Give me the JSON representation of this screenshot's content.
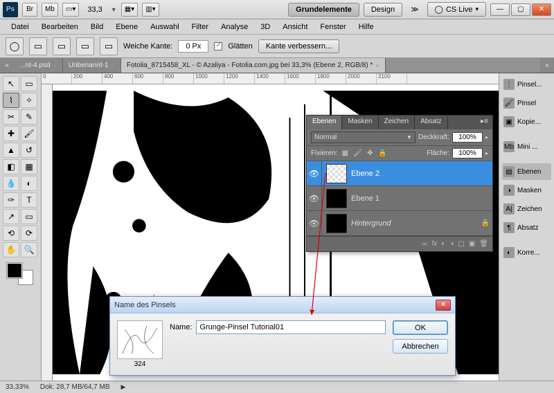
{
  "titlebar": {
    "app_abbrev": "Ps",
    "small_buttons": [
      "Br",
      "Mb"
    ],
    "zoom": "33,3",
    "workspace_tabs": {
      "active": "Grundelemente",
      "other": "Design"
    },
    "cslive": "CS Live"
  },
  "menubar": [
    "Datei",
    "Bearbeiten",
    "Bild",
    "Ebene",
    "Auswahl",
    "Filter",
    "Analyse",
    "3D",
    "Ansicht",
    "Fenster",
    "Hilfe"
  ],
  "optionbar": {
    "weiche_kante_label": "Weiche Kante:",
    "weiche_kante_value": "0 Px",
    "glaetten_label": "Glätten",
    "kante_btn": "Kante verbessern..."
  },
  "doc_tabs": {
    "items": [
      {
        "label": "...nt-4.psd",
        "close": "×"
      },
      {
        "label": "Unbenannt-1",
        "close": "×"
      },
      {
        "label": "Fotolia_8715458_XL - © Azaliya - Fotolia.com.jpg bei 33,3% (Ebene 2, RGB/8) *",
        "close": "×",
        "active": true
      }
    ]
  },
  "ruler_ticks": [
    "0",
    "200",
    "400",
    "600",
    "800",
    "1000",
    "1200",
    "1400",
    "1600",
    "1800",
    "2000",
    "2100"
  ],
  "right_strip": [
    "Pinsel...",
    "Pinsel",
    "Kopie...",
    "Mini ...",
    "Ebenen",
    "Masken",
    "Zeichen",
    "Absatz",
    "Korre..."
  ],
  "layers_panel": {
    "tabs": [
      "Ebenen",
      "Masken",
      "Zeichen",
      "Absatz"
    ],
    "blend_mode": "Normal",
    "deckkraft_label": "Deckkraft:",
    "deckkraft_value": "100%",
    "fixieren_label": "Fixieren:",
    "flaeche_label": "Fläche:",
    "flaeche_value": "100%",
    "layers": [
      {
        "name": "Ebene 2",
        "selected": true
      },
      {
        "name": "Ebene 1"
      },
      {
        "name": "Hintergrund",
        "italic": true,
        "locked": true
      }
    ]
  },
  "dialog": {
    "title": "Name des Pinsels",
    "preview_size": "324",
    "name_label": "Name:",
    "name_value": "Grunge-Pinsel Tutorial01",
    "ok": "OK",
    "cancel": "Abbrechen"
  },
  "status": {
    "zoom": "33,33%",
    "doc": "Dok: 28,7 MB/64,7 MB"
  }
}
